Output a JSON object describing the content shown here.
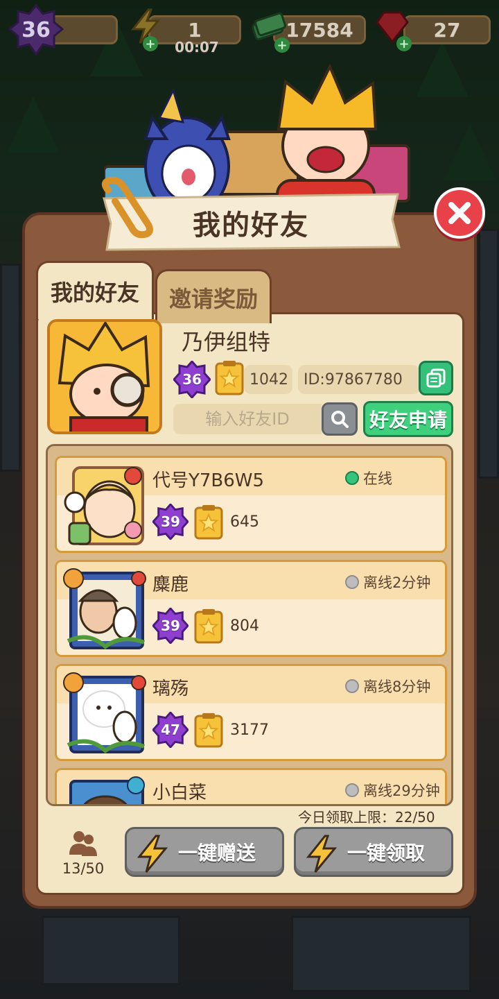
{
  "hud": {
    "level": "36",
    "energy": "1",
    "energy_timer": "00:07",
    "cash": "17584",
    "gems": "27"
  },
  "dialog": {
    "title": "我的好友",
    "tabs": [
      {
        "label": "我的好友",
        "active": true
      },
      {
        "label": "邀请奖励",
        "active": false
      }
    ]
  },
  "profile": {
    "name": "乃伊组特",
    "level": "36",
    "score": "1042",
    "id_text": "ID:97867780",
    "search_placeholder": "输入好友ID",
    "apply_label": "好友申请"
  },
  "friends": [
    {
      "name": "代号Y7B6W5",
      "status": "在线",
      "online": true,
      "level": "39",
      "score": "645"
    },
    {
      "name": "麋鹿",
      "status": "离线2分钟",
      "online": false,
      "level": "39",
      "score": "804"
    },
    {
      "name": "璃殇",
      "status": "离线8分钟",
      "online": false,
      "level": "47",
      "score": "3177"
    },
    {
      "name": "小白菜",
      "status": "离线29分钟",
      "online": false,
      "level": "",
      "score": ""
    }
  ],
  "footer": {
    "daily_limit": "今日领取上限：22/50",
    "friend_count": "13/50",
    "send_all_label": "一键赠送",
    "claim_all_label": "一键领取"
  },
  "colors": {
    "panel": "#8b5a3c",
    "panel_inner": "#f3e6c5",
    "close_red": "#e9414a",
    "green_button": "#3fd07d",
    "level_badge_purple": "#8e3fd0"
  }
}
